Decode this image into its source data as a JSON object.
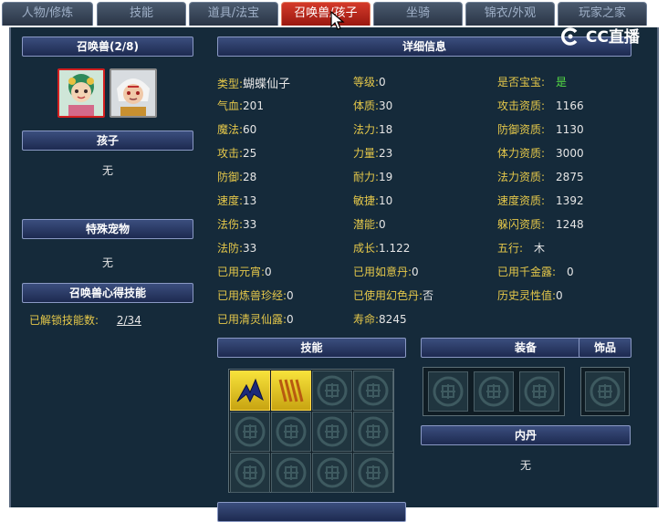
{
  "tabs": [
    {
      "label": "人物/修炼"
    },
    {
      "label": "技能"
    },
    {
      "label": "道具/法宝"
    },
    {
      "label": "召唤兽/孩子"
    },
    {
      "label": "坐骑"
    },
    {
      "label": "锦衣/外观"
    },
    {
      "label": "玩家之家"
    }
  ],
  "watermark": "CC直播",
  "left": {
    "summon_header": "召唤兽(2/8)",
    "child_header": "孩子",
    "child_value": "无",
    "special_header": "特殊宠物",
    "special_value": "无",
    "skill_header": "召唤兽心得技能",
    "unlock_label": "已解锁技能数:",
    "unlock_value": "2/34"
  },
  "detail": {
    "header": "详细信息",
    "col1": [
      {
        "label": "类型:",
        "value": "蝴蝶仙子"
      },
      {
        "label": "气血:",
        "value": "201"
      },
      {
        "label": "魔法:",
        "value": "60"
      },
      {
        "label": "攻击:",
        "value": "25"
      },
      {
        "label": "防御:",
        "value": "28"
      },
      {
        "label": "速度:",
        "value": "13"
      },
      {
        "label": "法伤:",
        "value": "33"
      },
      {
        "label": "法防:",
        "value": "33"
      },
      {
        "label": "已用元宵:",
        "value": "0"
      },
      {
        "label": "已用炼兽珍经:",
        "value": "0"
      },
      {
        "label": "已用清灵仙露:",
        "value": "0"
      }
    ],
    "col2": [
      {
        "label": "等级:",
        "value": "0"
      },
      {
        "label": "体质:",
        "value": "30"
      },
      {
        "label": "法力:",
        "value": "18"
      },
      {
        "label": "力量:",
        "value": "23"
      },
      {
        "label": "耐力:",
        "value": "19"
      },
      {
        "label": "敏捷:",
        "value": "10"
      },
      {
        "label": "潜能:",
        "value": "0"
      },
      {
        "label": "成长:",
        "value": "1.122"
      },
      {
        "label": "已用如意丹:",
        "value": "0"
      },
      {
        "label": "已使用幻色丹:",
        "value": "否"
      },
      {
        "label": "寿命:",
        "value": "8245"
      }
    ],
    "col3": [
      {
        "label": "是否宝宝:",
        "value": "是"
      },
      {
        "label": "攻击资质:",
        "value": "1166"
      },
      {
        "label": "防御资质:",
        "value": "1130"
      },
      {
        "label": "体力资质:",
        "value": "3000"
      },
      {
        "label": "法力资质:",
        "value": "2875"
      },
      {
        "label": "速度资质:",
        "value": "1392"
      },
      {
        "label": "躲闪资质:",
        "value": "1248"
      },
      {
        "label": "五行:",
        "value": "木"
      },
      {
        "label": "已用千金露:",
        "value": "0"
      },
      {
        "label": "历史灵性值:",
        "value": "0"
      }
    ]
  },
  "skills_header": "技能",
  "equip_header": "装备",
  "accessory_header": "饰品",
  "neidan_header": "内丹",
  "neidan_value": "无",
  "colors": {
    "label": "#e5c84a",
    "yes": "#55dd44",
    "active_tab": "#c42818"
  }
}
